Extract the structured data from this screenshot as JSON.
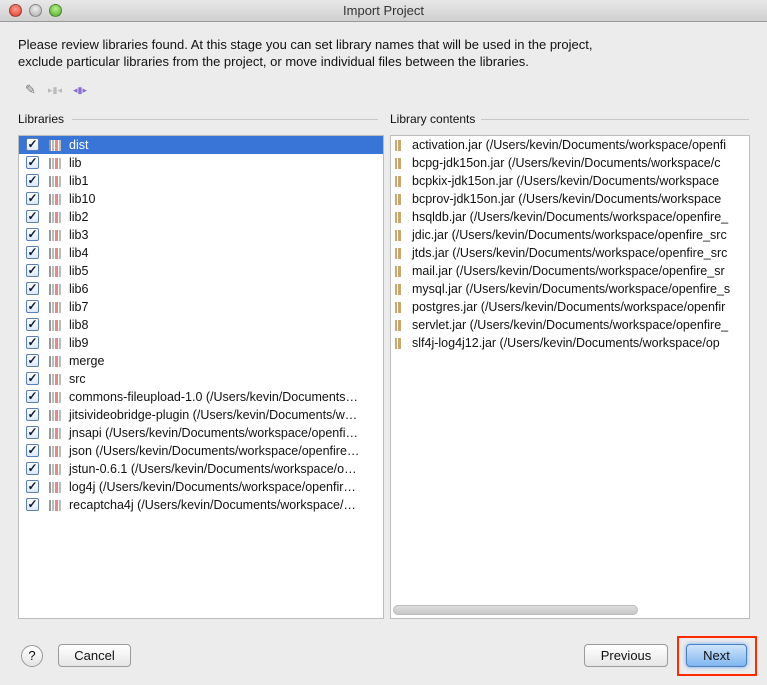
{
  "window": {
    "title": "Import Project"
  },
  "intro": [
    "Please review libraries found. At this stage you can set library names that will be used in the project,",
    "exclude particular libraries from the project, or move individual files between the libraries."
  ],
  "toolbar": {
    "rename": "✎",
    "exclude": "▸▮◂",
    "move": "◂▮▸"
  },
  "libraries": {
    "label": "Libraries",
    "items": [
      "dist",
      "lib",
      "lib1",
      "lib10",
      "lib2",
      "lib3",
      "lib4",
      "lib5",
      "lib6",
      "lib7",
      "lib8",
      "lib9",
      "merge",
      "src",
      "commons-fileupload-1.0 (/Users/kevin/Documents…",
      "jitsivideobridge-plugin (/Users/kevin/Documents/w…",
      "jnsapi (/Users/kevin/Documents/workspace/openfi…",
      "json (/Users/kevin/Documents/workspace/openfire…",
      "jstun-0.6.1 (/Users/kevin/Documents/workspace/o…",
      "log4j (/Users/kevin/Documents/workspace/openfir…",
      "recaptcha4j (/Users/kevin/Documents/workspace/…"
    ],
    "selected": 0
  },
  "contents": {
    "label": "Library contents",
    "items": [
      "activation.jar (/Users/kevin/Documents/workspace/openfi",
      "bcpg-jdk15on.jar (/Users/kevin/Documents/workspace/c",
      "bcpkix-jdk15on.jar (/Users/kevin/Documents/workspace",
      "bcprov-jdk15on.jar (/Users/kevin/Documents/workspace",
      "hsqldb.jar (/Users/kevin/Documents/workspace/openfire_",
      "jdic.jar (/Users/kevin/Documents/workspace/openfire_src",
      "jtds.jar (/Users/kevin/Documents/workspace/openfire_src",
      "mail.jar (/Users/kevin/Documents/workspace/openfire_sr",
      "mysql.jar (/Users/kevin/Documents/workspace/openfire_s",
      "postgres.jar (/Users/kevin/Documents/workspace/openfir",
      "servlet.jar (/Users/kevin/Documents/workspace/openfire_",
      "slf4j-log4j12.jar (/Users/kevin/Documents/workspace/op"
    ]
  },
  "buttons": {
    "help": "?",
    "cancel": "Cancel",
    "previous": "Previous",
    "next": "Next"
  },
  "colors": {
    "selection": "#3875d7",
    "highlight": "#ff2a00"
  }
}
